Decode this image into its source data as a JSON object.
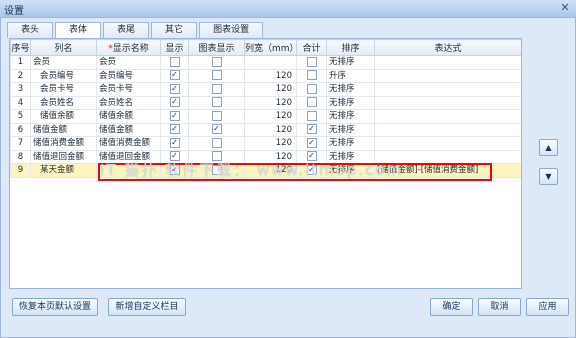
{
  "window": {
    "title": "设置",
    "close_glyph": "✕"
  },
  "tabs": [
    {
      "label": "表头",
      "active": false
    },
    {
      "label": "表体",
      "active": true
    },
    {
      "label": "表尾",
      "active": false
    },
    {
      "label": "其它",
      "active": false
    },
    {
      "label": "图表设置",
      "active": false
    }
  ],
  "table": {
    "headers": {
      "seq": "序号",
      "colname": "列名",
      "display_name_req": "*",
      "display_name": "显示名称",
      "show": "显示",
      "chart_show": "图表显示",
      "width": "列宽（mm）",
      "sum": "合计",
      "sort": "排序",
      "expr": "表达式"
    },
    "rows": [
      {
        "seq": "1",
        "colname": "会员",
        "display_name": "会员",
        "show": false,
        "chart_show": false,
        "width": "",
        "sum": false,
        "sort": "无排序",
        "expr": "",
        "indent": false
      },
      {
        "seq": "2",
        "colname": "会员编号",
        "display_name": "会员编号",
        "show": true,
        "chart_show": false,
        "width": "120",
        "sum": false,
        "sort": "升序",
        "expr": "",
        "indent": true
      },
      {
        "seq": "3",
        "colname": "会员卡号",
        "display_name": "会员卡号",
        "show": true,
        "chart_show": false,
        "width": "120",
        "sum": false,
        "sort": "无排序",
        "expr": "",
        "indent": true
      },
      {
        "seq": "4",
        "colname": "会员姓名",
        "display_name": "会员姓名",
        "show": true,
        "chart_show": false,
        "width": "120",
        "sum": false,
        "sort": "无排序",
        "expr": "",
        "indent": true
      },
      {
        "seq": "5",
        "colname": "储值余额",
        "display_name": "储值余额",
        "show": true,
        "chart_show": false,
        "width": "120",
        "sum": false,
        "sort": "无排序",
        "expr": "",
        "indent": true
      },
      {
        "seq": "6",
        "colname": "储值金额",
        "display_name": "储值金额",
        "show": true,
        "chart_show": true,
        "width": "120",
        "sum": true,
        "sort": "无排序",
        "expr": "",
        "indent": false
      },
      {
        "seq": "7",
        "colname": "储值消费金额",
        "display_name": "储值消费金额",
        "show": true,
        "chart_show": false,
        "width": "120",
        "sum": true,
        "sort": "无排序",
        "expr": "",
        "indent": false
      },
      {
        "seq": "8",
        "colname": "储值退回金额",
        "display_name": "储值退回金额",
        "show": true,
        "chart_show": false,
        "width": "120",
        "sum": true,
        "sort": "无排序",
        "expr": "",
        "indent": false
      },
      {
        "seq": "9",
        "colname": "某天金额",
        "display_name": "",
        "show": true,
        "chart_show": false,
        "width": "120",
        "sum": true,
        "sort": "无排序",
        "expr": "[储值金额]-[储值消费金额]",
        "indent": true,
        "highlighted": true
      }
    ]
  },
  "side_buttons": {
    "up": "▲",
    "down": "▼"
  },
  "watermark": "IT 猫扑 软件下载：  www.itmop.com",
  "footer": {
    "restore_default": "恢复本页默认设置",
    "add_custom_column": "新增自定义栏目",
    "ok": "确定",
    "cancel": "取消",
    "apply": "应用"
  },
  "colors": {
    "highlight_row": "#fff3c0",
    "red_box": "#e00d0d",
    "frame_bg": "#dde9f7"
  }
}
